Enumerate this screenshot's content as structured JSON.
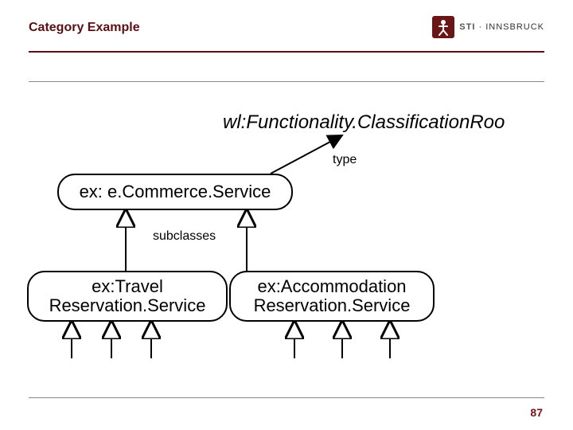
{
  "header": {
    "title": "Category Example",
    "logo": {
      "brand": "STI",
      "sep": " · ",
      "place": "INNSBRUCK"
    }
  },
  "diagram": {
    "target": "wl:Functionality.ClassificationRoo",
    "type_label": "type",
    "subclasses_label": "subclasses",
    "parent": "ex: e.Commerce.Service",
    "left": {
      "line1": "ex:Travel",
      "line2": "Reservation.Service"
    },
    "right": {
      "line1": "ex:Accommodation",
      "line2": "Reservation.Service"
    }
  },
  "footer": {
    "page": "87"
  }
}
